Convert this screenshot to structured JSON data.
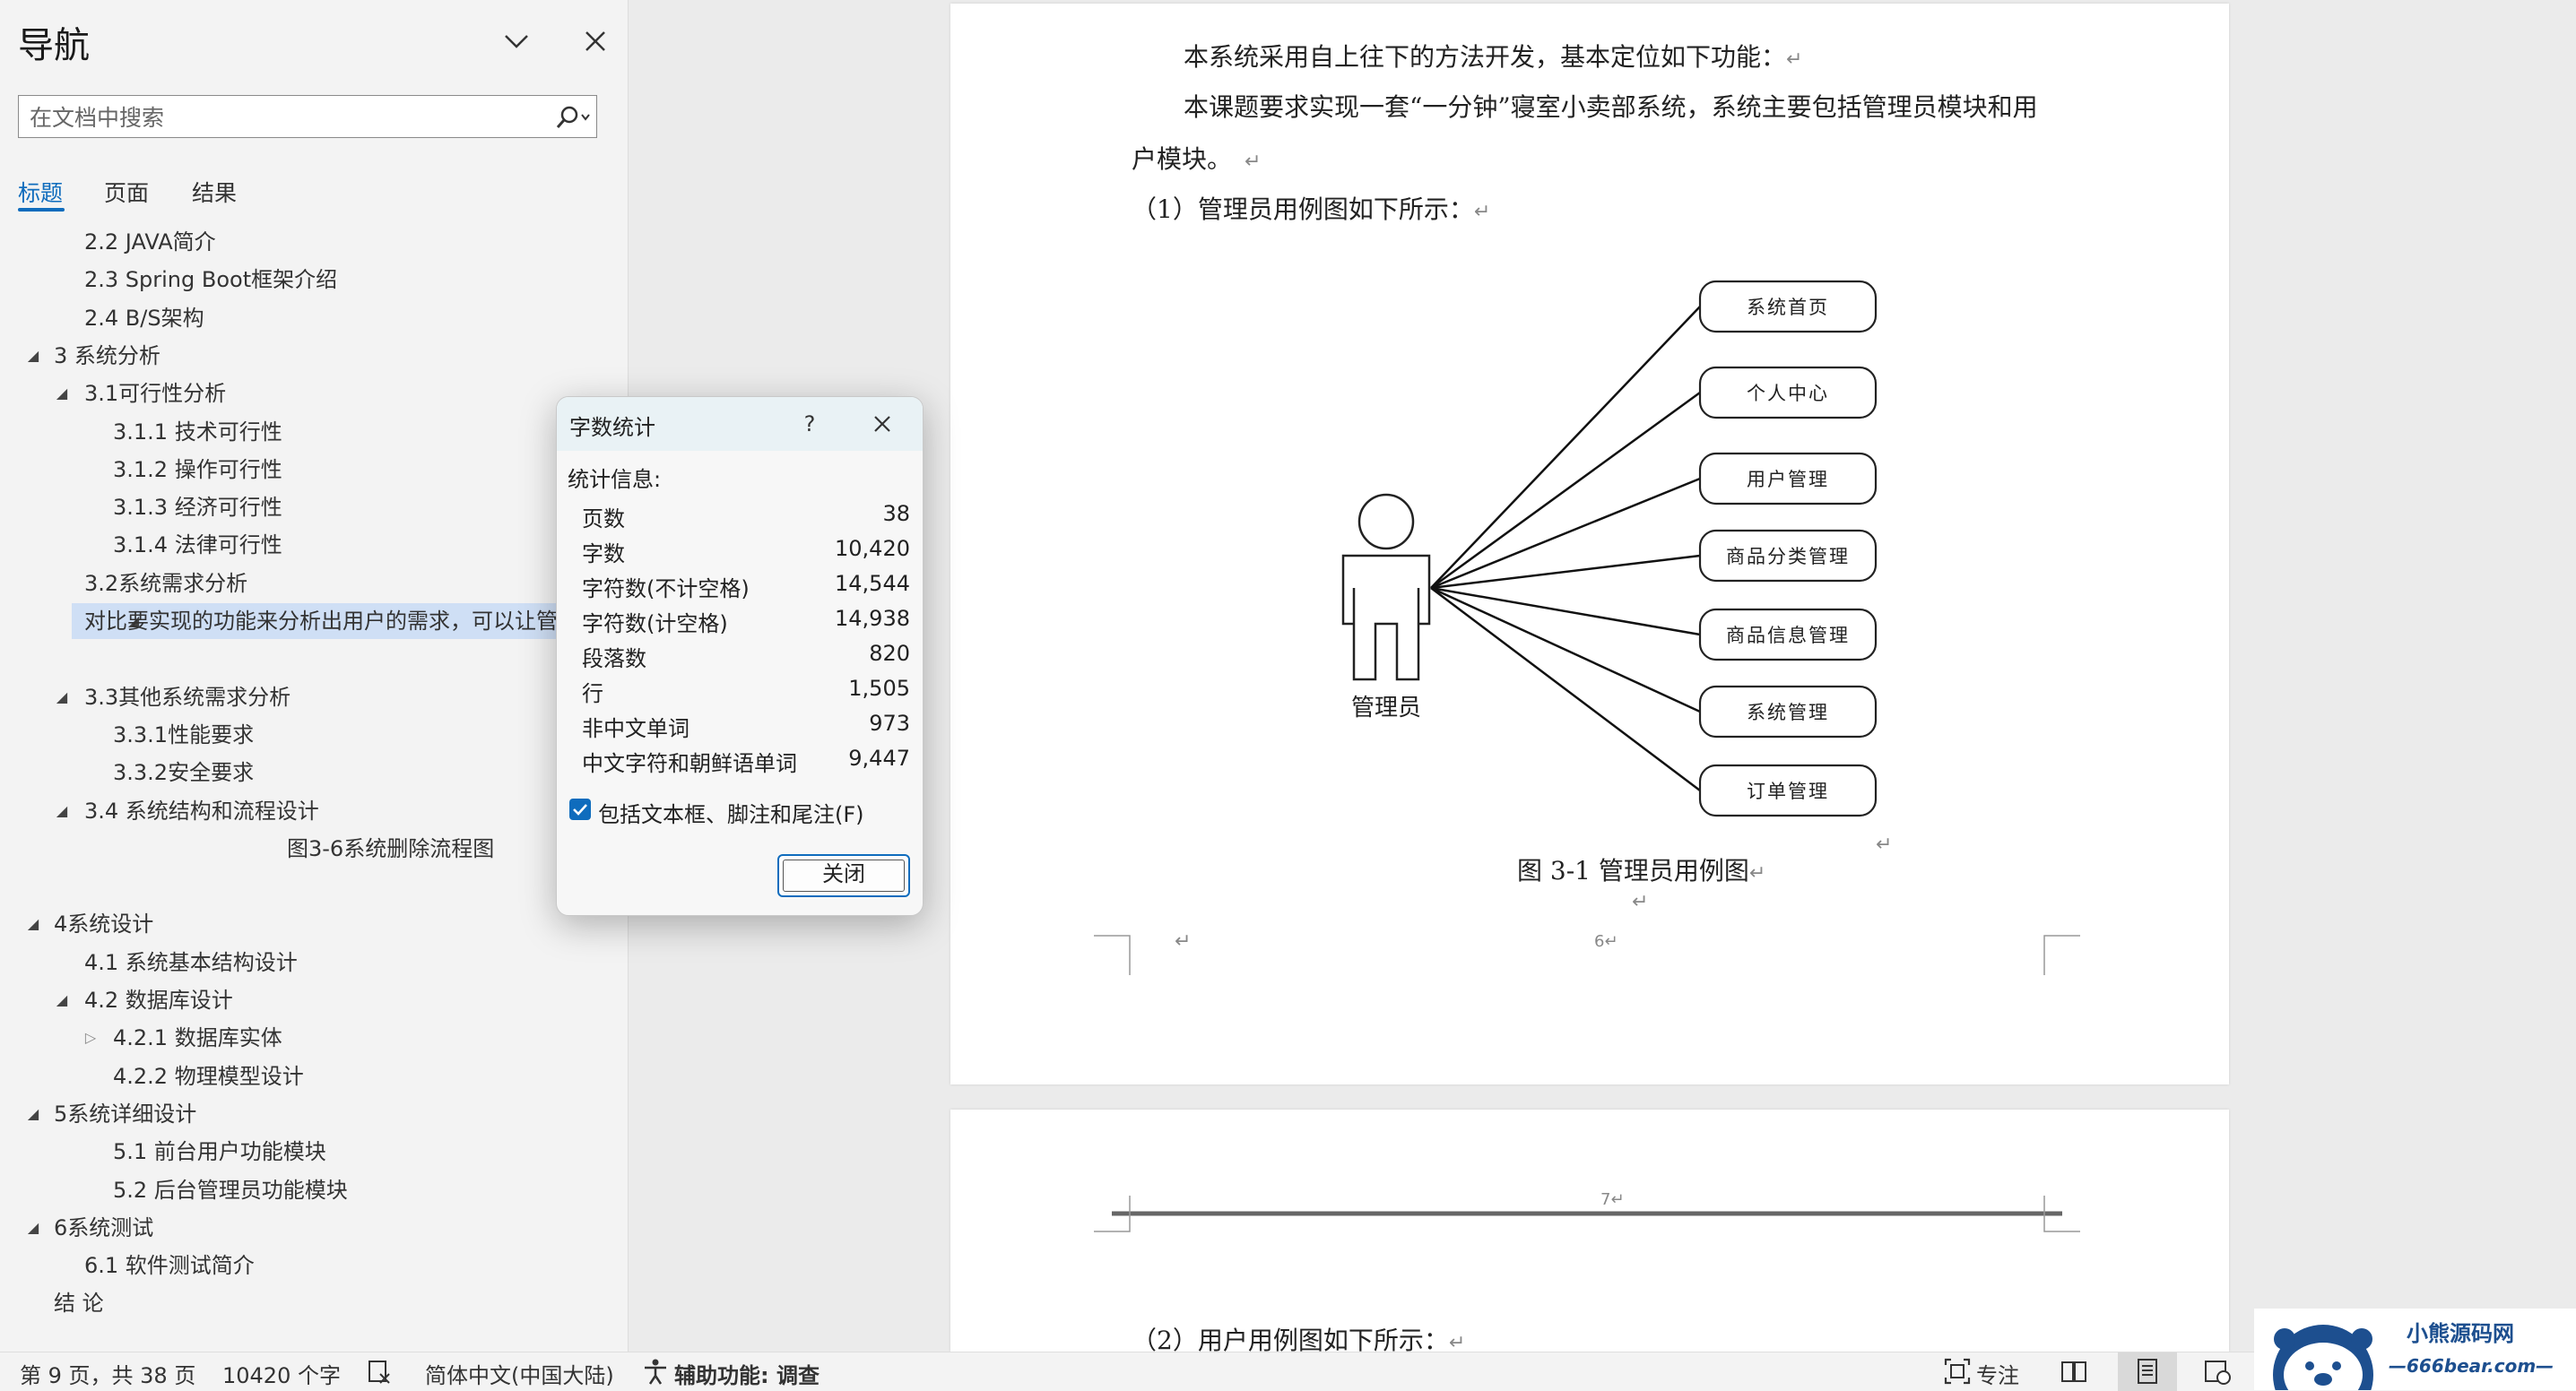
{
  "navigation": {
    "title": "导航",
    "search_placeholder": "在文档中搜索",
    "tabs": [
      {
        "label": "标题",
        "active": true
      },
      {
        "label": "页面",
        "active": false
      },
      {
        "label": "结果",
        "active": false
      }
    ],
    "headings": [
      {
        "text": "2.2 JAVA简介",
        "level": 2,
        "caret": "none"
      },
      {
        "text": "2.3 Spring Boot框架介绍",
        "level": 2,
        "caret": "none"
      },
      {
        "text": "2.4  B/S架构",
        "level": 2,
        "caret": "none"
      },
      {
        "text": "3 系统分析",
        "level": 1,
        "caret": "expanded"
      },
      {
        "text": "3.1可行性分析",
        "level": 2,
        "caret": "expanded"
      },
      {
        "text": "3.1.1 技术可行性",
        "level": 3,
        "caret": "none"
      },
      {
        "text": "3.1.2 操作可行性",
        "level": 3,
        "caret": "none"
      },
      {
        "text": "3.1.3 经济可行性",
        "level": 3,
        "caret": "none"
      },
      {
        "text": "3.1.4 法律可行性",
        "level": 3,
        "caret": "none"
      },
      {
        "text": "3.2系统需求分析",
        "level": 2,
        "caret": "none"
      },
      {
        "text": "对比要实现的功能来分析出用户的需求，可以让管",
        "level": 2,
        "caret": "expanded",
        "selected": true
      },
      {
        "text": "",
        "level": 2,
        "caret": "none"
      },
      {
        "text": "3.3其他系统需求分析",
        "level": 2,
        "caret": "expanded"
      },
      {
        "text": "3.3.1性能要求",
        "level": 3,
        "caret": "none"
      },
      {
        "text": "3.3.2安全要求",
        "level": 3,
        "caret": "none"
      },
      {
        "text": "3.4 系统结构和流程设计",
        "level": 2,
        "caret": "expanded"
      },
      {
        "text": "图3-6系统删除流程图",
        "level": 5,
        "caret": "none"
      },
      {
        "text": "",
        "level": 1,
        "caret": "none"
      },
      {
        "text": "4系统设计",
        "level": 1,
        "caret": "expanded"
      },
      {
        "text": "4.1 系统基本结构设计",
        "level": 2,
        "caret": "none"
      },
      {
        "text": "4.2 数据库设计",
        "level": 2,
        "caret": "expanded"
      },
      {
        "text": "4.2.1 数据库实体",
        "level": 3,
        "caret": "collapsed"
      },
      {
        "text": "4.2.2 物理模型设计",
        "level": 3,
        "caret": "none"
      },
      {
        "text": "5系统详细设计",
        "level": 1,
        "caret": "expanded"
      },
      {
        "text": "5.1 前台用户功能模块",
        "level": 3,
        "caret": "none"
      },
      {
        "text": "5.2 后台管理员功能模块",
        "level": 3,
        "caret": "none"
      },
      {
        "text": " 6系统测试",
        "level": 1,
        "caret": "expanded"
      },
      {
        "text": "6.1 软件测试简介",
        "level": 2,
        "caret": "none"
      },
      {
        "text": "结  论",
        "level": 1,
        "caret": "none"
      }
    ]
  },
  "document": {
    "page1_lines": [
      "本系统采用自上往下的方法开发，基本定位如下功能：",
      "本课题要求实现一套“一分钟”寝室小卖部系统，系统主要包括管理员模块和用",
      "户模块。",
      "（1）管理员用例图如下所示："
    ],
    "para_mark": "↵",
    "actor_label": "管理员",
    "use_cases": [
      "系统首页",
      "个人中心",
      "用户管理",
      "商品分类管理",
      "商品信息管理",
      "系统管理",
      "订单管理"
    ],
    "figure_caption": "图 3-1 管理员用例图",
    "page_number_1": "6",
    "page_number_2": "7",
    "page2_line": "（2）用户用例图如下所示："
  },
  "dialog": {
    "title": "字数统计",
    "help_label": "?",
    "stats_heading": "统计信息:",
    "stats": [
      {
        "label": "页数",
        "value": "38"
      },
      {
        "label": "字数",
        "value": "10,420"
      },
      {
        "label": "字符数(不计空格)",
        "value": "14,544"
      },
      {
        "label": "字符数(计空格)",
        "value": "14,938"
      },
      {
        "label": "段落数",
        "value": "820"
      },
      {
        "label": "行",
        "value": "1,505"
      },
      {
        "label": "非中文单词",
        "value": "973"
      },
      {
        "label": "中文字符和朝鲜语单词",
        "value": "9,447"
      }
    ],
    "include_checkbox_label": "包括文本框、脚注和尾注(F)",
    "include_checked": true,
    "close_button_label": "关闭"
  },
  "statusbar": {
    "page_info": "第 9 页，共 38 页",
    "word_count": "10420 个字",
    "language": "简体中文(中国大陆)",
    "accessibility": "辅助功能: 调查",
    "focus": "专注"
  },
  "watermark": {
    "line1": "小熊源码网",
    "line2": "—666bear.com—"
  },
  "colors": {
    "accent": "#0f6cbd",
    "selected_heading_bg": "#cfdff5",
    "dialog_titlebar": "#e9f2f5"
  }
}
